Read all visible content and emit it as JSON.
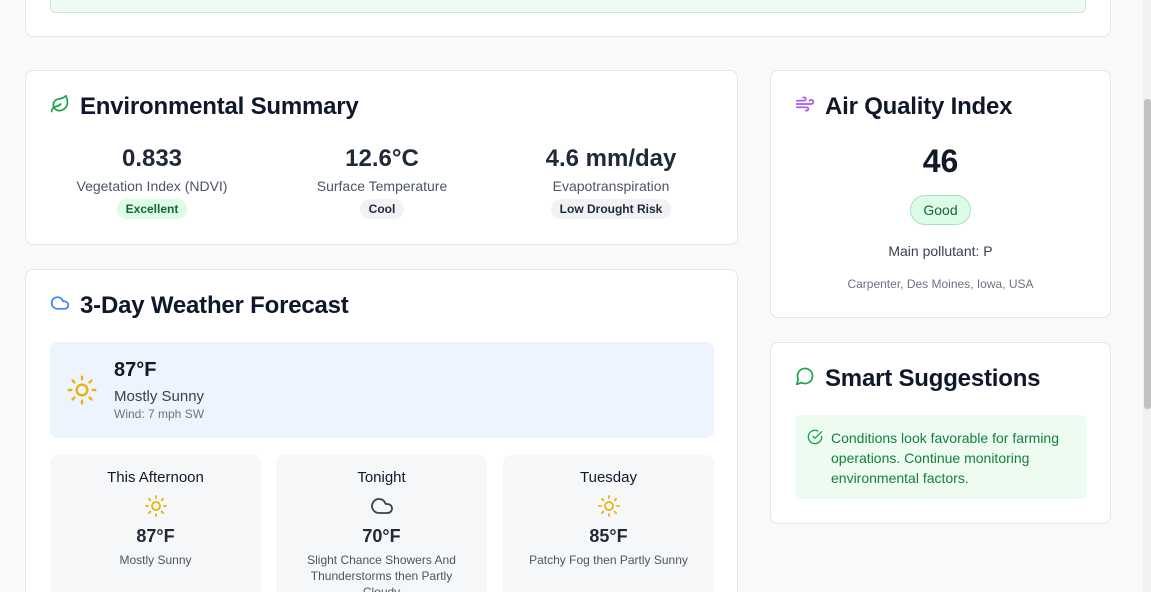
{
  "environmental_summary": {
    "title": "Environmental Summary",
    "metrics": [
      {
        "value": "0.833",
        "label": "Vegetation Index (NDVI)",
        "badge": "Excellent",
        "badge_color": "#dcfce7"
      },
      {
        "value": "12.6°C",
        "label": "Surface Temperature",
        "badge": "Cool",
        "badge_color": "#f1f2f4"
      },
      {
        "value": "4.6 mm/day",
        "label": "Evapotranspiration",
        "badge": "Low Drought Risk",
        "badge_color": "#f1f2f4"
      }
    ],
    "icon": "leaf-icon"
  },
  "weather": {
    "title": "3-Day Weather Forecast",
    "icon": "cloud-icon",
    "current": {
      "temp": "87°F",
      "condition": "Mostly Sunny",
      "wind": "Wind: 7 mph SW",
      "icon": "sun-icon"
    },
    "periods": [
      {
        "name": "This Afternoon",
        "temp": "87°F",
        "condition": "Mostly Sunny",
        "icon": "sun-icon"
      },
      {
        "name": "Tonight",
        "temp": "70°F",
        "condition": "Slight Chance Showers And Thunderstorms then Partly Cloudy",
        "icon": "cloud-icon"
      },
      {
        "name": "Tuesday",
        "temp": "85°F",
        "condition": "Patchy Fog then Partly Sunny",
        "icon": "sun-icon"
      }
    ]
  },
  "air_quality": {
    "title": "Air Quality Index",
    "icon": "wind-icon",
    "value": "46",
    "status": "Good",
    "pollutant": "Main pollutant: P",
    "location": "Carpenter, Des Moines, Iowa, USA"
  },
  "suggestions": {
    "title": "Smart Suggestions",
    "icon": "message-circle-icon",
    "items": [
      {
        "text": "Conditions look favorable for farming operations. Continue monitoring environmental factors.",
        "icon": "check-circle-icon"
      }
    ]
  },
  "colors": {
    "accent_green": "#16a34a",
    "accent_blue": "#3b82f6",
    "accent_purple": "#a855f7",
    "sun_yellow": "#eab308"
  }
}
